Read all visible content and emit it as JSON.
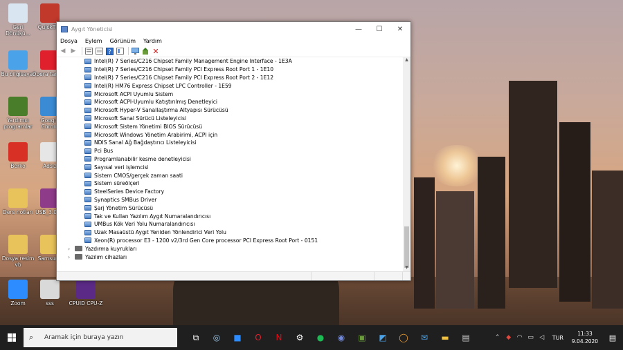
{
  "desktop": {
    "icons": [
      {
        "label": "Geri Dönüşü...",
        "color": "#d9e6f2"
      },
      {
        "label": "QuickTi...",
        "color": "#c0392b"
      },
      {
        "label": "Bu bilgisayar",
        "color": "#4aa3e8"
      },
      {
        "label": "Opera taray...",
        "color": "#e0202d"
      },
      {
        "label": "Yardımcı programlar",
        "color": "#4a7d2a"
      },
      {
        "label": "Google Chrom",
        "color": "#3a8bd4"
      },
      {
        "label": "Berko",
        "color": "#d93025"
      },
      {
        "label": "Adsız",
        "color": "#e6e6e6"
      },
      {
        "label": "Ders notları",
        "color": "#e8c25a"
      },
      {
        "label": "USB_3.0_...",
        "color": "#8e3b8a"
      },
      {
        "label": "Dosya.resim vb",
        "color": "#e8c25a"
      },
      {
        "label": "Samsung",
        "color": "#e8c25a"
      },
      {
        "label": "Zoom",
        "color": "#2d8cff"
      },
      {
        "label": "sss",
        "color": "#d9d9d9"
      },
      {
        "label": "CPUID CPU-Z",
        "color": "#5b2a86"
      }
    ]
  },
  "window": {
    "title": "Aygıt Yöneticisi",
    "controls": {
      "minimize": "—",
      "maximize": "☐",
      "close": "✕"
    },
    "menu": [
      "Dosya",
      "Eylem",
      "Görünüm",
      "Yardım"
    ],
    "toolbar_icons": [
      "back-icon",
      "forward-icon",
      "properties-icon",
      "details-icon",
      "help-icon",
      "view-icon",
      "monitor-icon",
      "update-driver-icon",
      "remove-icon"
    ],
    "devices": [
      "Intel(R) 7 Series/C216 Chipset Family Management Engine Interface - 1E3A",
      "Intel(R) 7 Series/C216 Chipset Family PCI Express Root Port 1 - 1E10",
      "Intel(R) 7 Series/C216 Chipset Family PCI Express Root Port 2 - 1E12",
      "Intel(R) HM76 Express Chipset LPC Controller - 1E59",
      "Microsoft ACPI Uyumlu Sistem",
      "Microsoft ACPI-Uyumlu Katıştırılmış Denetleyici",
      "Microsoft Hyper-V Sanallaştırma Altyapısı Sürücüsü",
      "Microsoft Sanal Sürücü Listeleyicisi",
      "Microsoft Sistem Yönetimi BIOS Sürücüsü",
      "Microsoft Windows Yönetim Arabirimi, ACPI için",
      "NDIS Sanal Ağ Bağdaştırıcı Listeleyicisi",
      "Pci Bus",
      "Programlanabilir kesme denetleyicisi",
      "Sayısal veri işlemcisi",
      "Sistem CMOS/gerçek zaman saati",
      "Sistem süreölçeri",
      "SteelSeries Device Factory",
      "Synaptics SMBus Driver",
      "Şarj Yönetim Sürücüsü",
      "Tak ve Kullan Yazılım Aygıt Numaralandırıcısı",
      "UMBus Kök Veri Yolu Numaralandırıcısı",
      "Uzak Masaüstü Aygıt Yeniden Yönlendirici Veri Yolu",
      "Xeon(R) processor E3 - 1200 v2/3rd Gen Core processor PCI Express Root Port - 0151"
    ],
    "categories": [
      "Yazdırma kuyrukları",
      "Yazılım cihazları"
    ]
  },
  "taskbar": {
    "search_placeholder": "Aramak için buraya yazın",
    "apps": [
      "task-view-icon",
      "steam-icon",
      "zoom-icon",
      "opera-icon",
      "netflix-icon",
      "settings-icon",
      "spotify-icon",
      "discord-icon",
      "minecraft-icon",
      "photos-icon",
      "app-icon",
      "mail-icon",
      "file-explorer-icon",
      "device-manager-icon"
    ],
    "language": "TUR",
    "time": "11:33",
    "date": "9.04.2020"
  }
}
